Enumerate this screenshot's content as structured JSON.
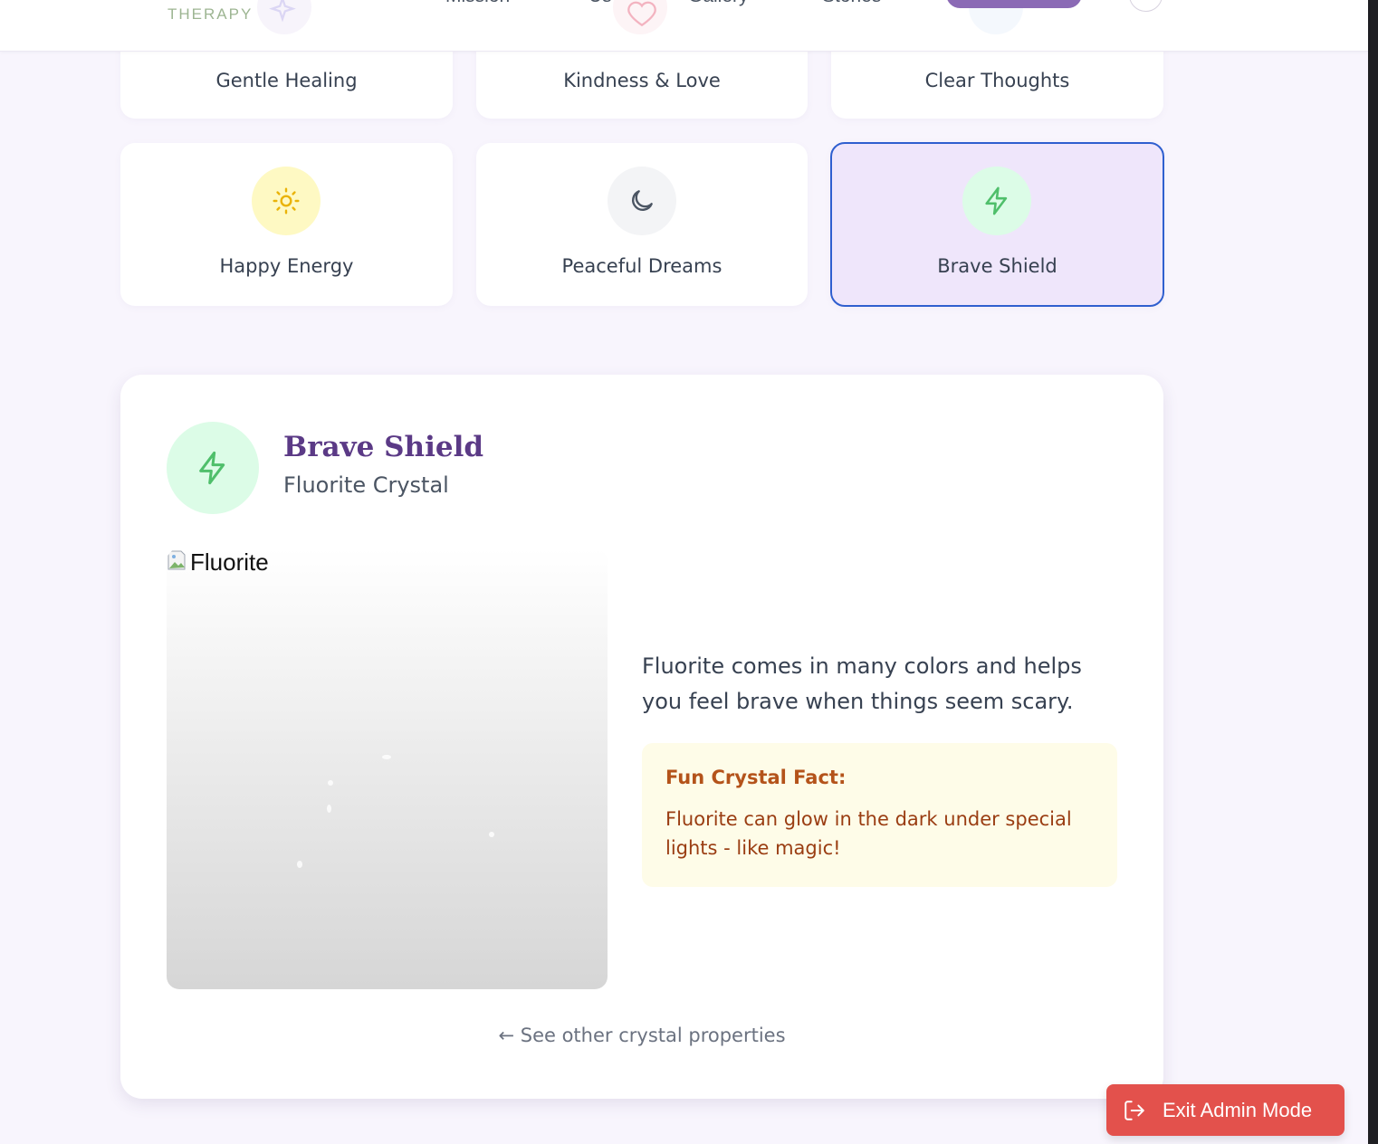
{
  "header": {
    "logo_sub": "THERAPY",
    "nav": [
      "Mission",
      "Us",
      "Gallery",
      "Stories"
    ]
  },
  "cards_top": [
    {
      "label": "Gentle Healing"
    },
    {
      "label": "Kindness & Love"
    },
    {
      "label": "Clear Thoughts"
    }
  ],
  "cards_bottom": [
    {
      "label": "Happy Energy",
      "icon": "sun-icon",
      "color": "#eab308",
      "bg": "#fef9c3"
    },
    {
      "label": "Peaceful Dreams",
      "icon": "moon-icon",
      "color": "#4b5563",
      "bg": "#f3f4f6"
    },
    {
      "label": "Brave Shield",
      "icon": "lightning-icon",
      "color": "#4fbf6b",
      "bg": "#dcfce7",
      "selected": true
    }
  ],
  "detail": {
    "title": "Brave Shield",
    "subtitle": "Fluorite Crystal",
    "image_alt": "Fluorite",
    "description": "Fluorite comes in many colors and helps you feel brave when things seem scary.",
    "fact_title": "Fun Crystal Fact:",
    "fact_text": "Fluorite can glow in the dark under special lights - like magic!",
    "back_link": "← See other crystal properties"
  },
  "admin": {
    "exit_label": "Exit Admin Mode"
  },
  "colors": {
    "accent_purple": "#5b3a86",
    "selected_border": "#2f5fcf",
    "exit_red": "#e3514c"
  }
}
